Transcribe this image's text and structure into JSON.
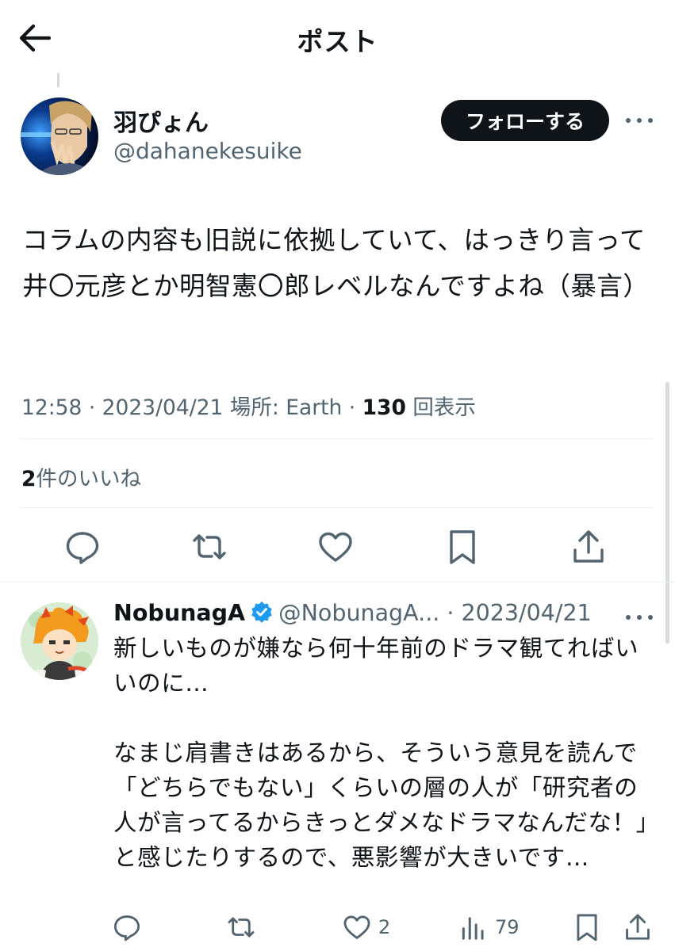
{
  "header": {
    "title": "ポスト",
    "back_icon": "arrow-left-icon"
  },
  "tweet": {
    "author": {
      "name": "羽ぴょん",
      "handle": "@dahanekesuike"
    },
    "follow_label": "フォローする",
    "text": "コラムの内容も旧説に依拠していて、はっきり言って井〇元彦とか明智憲〇郎レベルなんですよね（暴言）",
    "time": "12:58",
    "date": "2023/04/21",
    "location_label": "場所: Earth",
    "views_count": "130",
    "views_label": "回表示",
    "likes_count": "2",
    "likes_label": "件のいいね",
    "actions": [
      "reply-icon",
      "retweet-icon",
      "heart-icon",
      "bookmark-icon",
      "share-icon"
    ]
  },
  "reply": {
    "name": "NobunagA",
    "handle": "@NobunagA...",
    "date": "2023/04/21",
    "verified": true,
    "text": "新しいものが嫌なら何十年前のドラマ観てればいいのに…\n\nなまじ肩書きはあるから、そういう意見を読んで「どちらでもない」くらいの層の人が「研究者の人が言ってるからきっとダメなドラマなんだな！」と感じたりするので、悪影響が大きいです…",
    "like_count": "2",
    "view_count": "79"
  },
  "colors": {
    "text": "#0f1419",
    "secondary": "#536471",
    "divider": "#eff3f4",
    "verified": "#1d9bf0",
    "button_bg": "#0f1419"
  }
}
